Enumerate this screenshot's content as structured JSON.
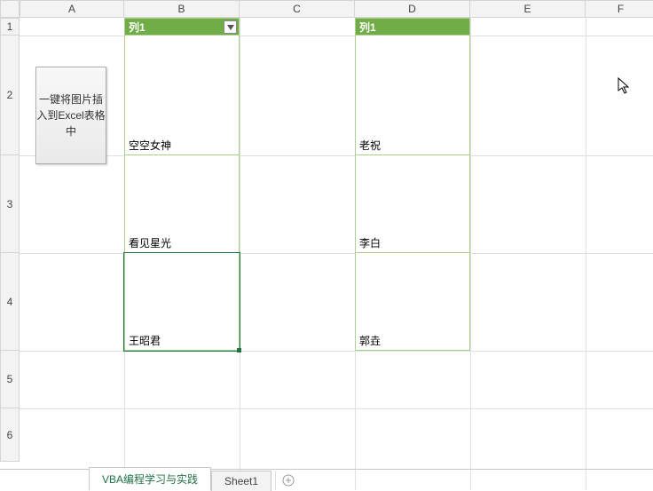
{
  "columns": [
    "A",
    "B",
    "C",
    "D",
    "E",
    "F"
  ],
  "rows": [
    "1",
    "2",
    "3",
    "4",
    "5",
    "6"
  ],
  "button": {
    "label": "一键将图片插入到Excel表格中"
  },
  "tableB": {
    "header": "列1",
    "cells": [
      "空空女神",
      "看见星光",
      "王昭君"
    ]
  },
  "tableD": {
    "header": "列1",
    "cells": [
      "老祝",
      "李白",
      "郭垚"
    ]
  },
  "tabs": {
    "active": "VBA编程学习与实践",
    "other": "Sheet1"
  },
  "selected_cell": "B4"
}
